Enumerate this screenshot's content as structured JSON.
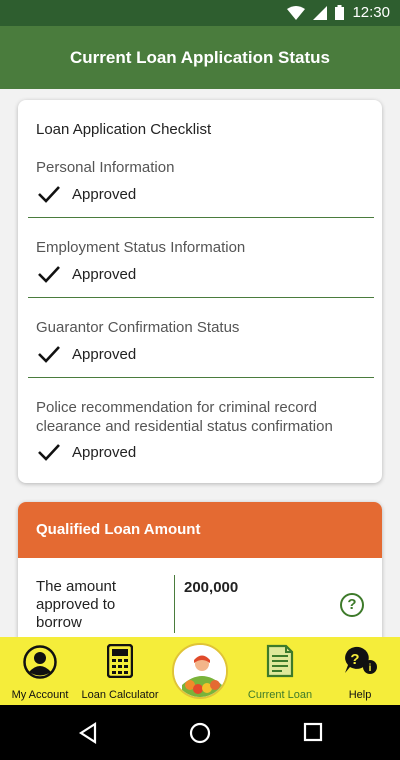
{
  "status_bar": {
    "time": "12:30"
  },
  "app_bar": {
    "title": "Current Loan Application Status"
  },
  "checklist": {
    "title": "Loan Application Checklist",
    "items": [
      {
        "label": "Personal Information",
        "status": "Approved"
      },
      {
        "label": "Employment Status Information",
        "status": "Approved"
      },
      {
        "label": "Guarantor Confirmation Status",
        "status": "Approved"
      },
      {
        "label": "Police recommendation for criminal record clearance and residential status confirmation",
        "status": "Approved"
      }
    ]
  },
  "loan_amount": {
    "header": "Qualified Loan Amount",
    "label": "The amount approved to borrow",
    "value": "200,000",
    "help_symbol": "?"
  },
  "bottom_nav": {
    "items": [
      {
        "label": "My Account",
        "icon": "account-icon"
      },
      {
        "label": "Loan Calculator",
        "icon": "calculator-icon"
      },
      {
        "label": "",
        "icon": "app-logo"
      },
      {
        "label": "Current Loan",
        "icon": "document-icon",
        "active": true
      },
      {
        "label": "Help",
        "icon": "help-icon"
      }
    ]
  },
  "colors": {
    "app_bar": "#4a7c3d",
    "status_bar": "#2e5e2f",
    "accent_orange": "#e46a32",
    "nav_yellow": "#f5ed3a",
    "active_green": "#3d7a2a"
  }
}
